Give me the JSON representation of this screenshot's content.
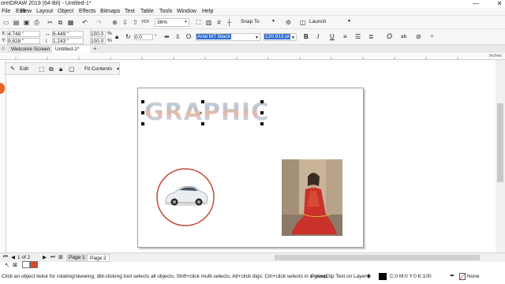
{
  "titlebar": {
    "title": "oreIDRAW 2019 (64-Bit) - Untitled-1*",
    "minimize": "—",
    "close": "✕"
  },
  "menu": {
    "items": [
      "File",
      "Edit",
      "View",
      "Layout",
      "Object",
      "Effects",
      "Bitmaps",
      "Text",
      "Table",
      "Tools",
      "Window",
      "Help"
    ]
  },
  "toolbar": {
    "zoom": "36%",
    "snap_to": "Snap To",
    "launch": "Launch"
  },
  "propbar": {
    "x_label": "X:",
    "x": "4.748 \"",
    "y_label": "Y:",
    "y": "9.828 \"",
    "w": "6.449 \"",
    "h": "1.243 \"",
    "scale_w": "100.0",
    "scale_h": "100.0",
    "pct": "%",
    "angle": "0.0",
    "degree": "°",
    "font": "Arial MT Black",
    "font_size": "120.913 pt",
    "bold": "B",
    "italic": "I",
    "underline": "U",
    "abl": "ab"
  },
  "tabs": {
    "welcome": "Welcome Screen",
    "doc": "Untitled-1*",
    "add": "+"
  },
  "ruler": {
    "units": "inches"
  },
  "floatbar": {
    "edit": "Edit",
    "fit": "Fit Contents"
  },
  "artwork": {
    "text": "GRAPHIC"
  },
  "pagenav": {
    "count": "1 of 2",
    "page1": "Page 1",
    "page2": "Page 2"
  },
  "status": {
    "hint": "Click an object twice for rotating/skewing; dbl-clicking tool selects all objects; Shift+click multi-selects; Alt+click digs; Ctrl+click selects in a group",
    "powerclip": "PowerClip Text on Layer 1",
    "cmyk": "C:0 M:0 Y:0 K:100",
    "outline": "None"
  },
  "colors": {
    "accent": "#d8452a",
    "selection": "#000000",
    "tab_active": "#ffffff"
  }
}
